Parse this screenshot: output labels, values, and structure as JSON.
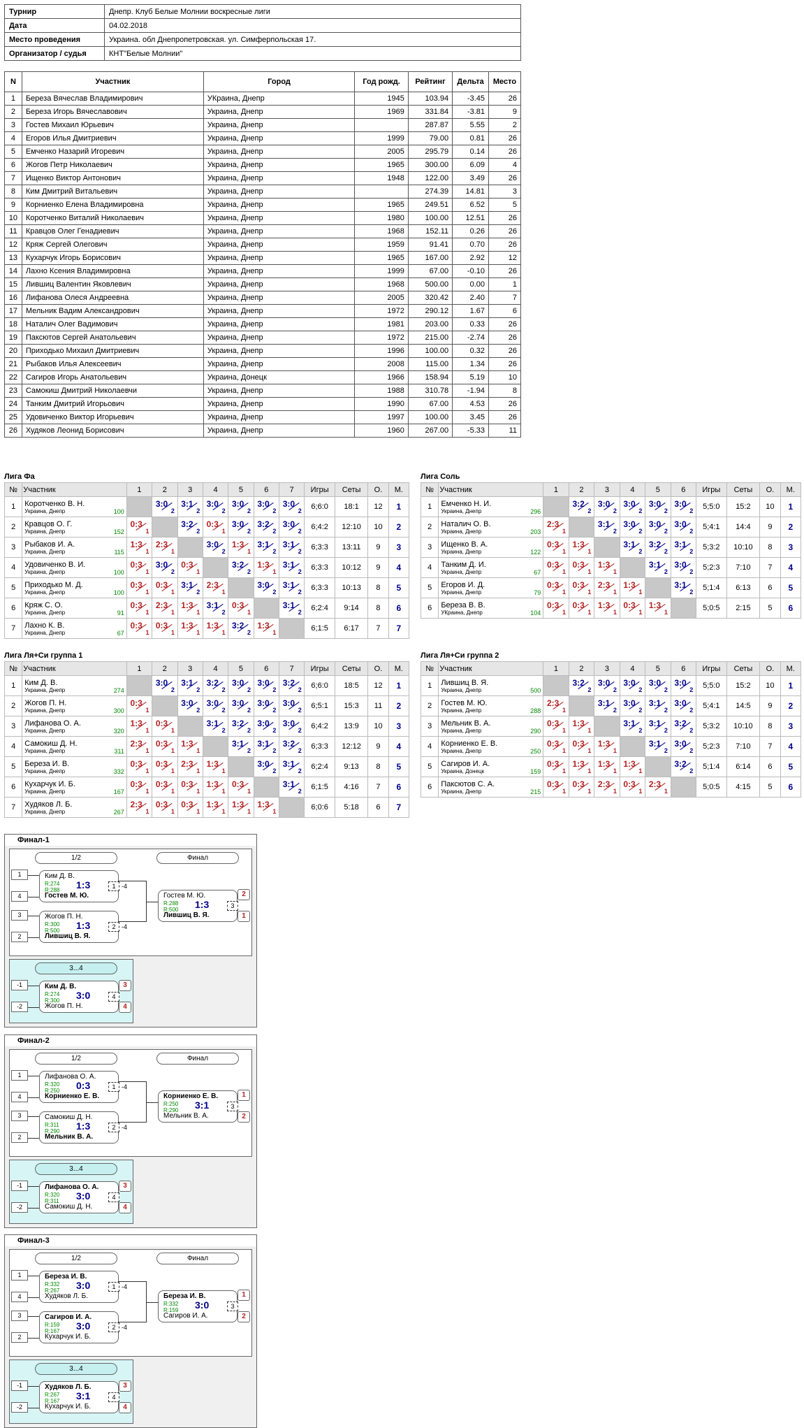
{
  "info": [
    {
      "k": "Турнир",
      "v": "Днепр. Клуб Белые Молнии воскресные лиги"
    },
    {
      "k": "Дата",
      "v": "04.02.2018"
    },
    {
      "k": "Место проведения",
      "v": "Украина. обл Днепропетровская. ул. Симферпольская 17."
    },
    {
      "k": "Организатор / судья",
      "v": "КНТ\"Белые Молнии\""
    }
  ],
  "players_header": [
    "N",
    "Участник",
    "Город",
    "Год рожд.",
    "Рейтинг",
    "Дельта",
    "Место"
  ],
  "players": [
    [
      "1",
      "Береза Вячеслав Владимирович",
      "УКраина, Днепр",
      "1945",
      "103.94",
      "-3.45",
      "26"
    ],
    [
      "2",
      "Береза Игорь Вячеславович",
      "Украина, Днепр",
      "1969",
      "331.84",
      "-3.81",
      "9"
    ],
    [
      "3",
      "Гостев Михаил Юрьевич",
      "Украина, Днепр",
      "",
      "287.87",
      "5.55",
      "2"
    ],
    [
      "4",
      "Егоров Илья Дмитриевич",
      "Украина, Днепр",
      "1999",
      "79.00",
      "0.81",
      "26"
    ],
    [
      "5",
      "Емченко Назарий Игоревич",
      "Украина, Днепр",
      "2005",
      "295.79",
      "0.14",
      "26"
    ],
    [
      "6",
      "Жогов Петр Николаевич",
      "Украина, Днепр",
      "1965",
      "300.00",
      "6.09",
      "4"
    ],
    [
      "7",
      "Ищенко Виктор Антонович",
      "Украина, Днепр",
      "1948",
      "122.00",
      "3.49",
      "26"
    ],
    [
      "8",
      "Ким Дмитрий Витальевич",
      "Украина, Днепр",
      "",
      "274.39",
      "14.81",
      "3"
    ],
    [
      "9",
      "Корниенко Елена Владимировна",
      "Украина, Днепр",
      "1965",
      "249.51",
      "6.52",
      "5"
    ],
    [
      "10",
      "Коротченко Виталий Николаевич",
      "Украина, Днепр",
      "1980",
      "100.00",
      "12.51",
      "26"
    ],
    [
      "11",
      "Кравцов Олег Генадиевич",
      "Украина, Днепр",
      "1968",
      "152.11",
      "0.26",
      "26"
    ],
    [
      "12",
      "Кряж Сергей Олегович",
      "Украина, Днепр",
      "1959",
      "91.41",
      "0.70",
      "26"
    ],
    [
      "13",
      "Кухарчук Игорь Борисович",
      "Украина, Днепр",
      "1965",
      "167.00",
      "2.92",
      "12"
    ],
    [
      "14",
      "Лахно Ксения Владимировна",
      "Украина, Днепр",
      "1999",
      "67.00",
      "-0.10",
      "26"
    ],
    [
      "15",
      "Лившиц Валентин Яковлевич",
      "Украина, Днепр",
      "1968",
      "500.00",
      "0.00",
      "1"
    ],
    [
      "16",
      "Лифанова Олеся Андреевна",
      "Украина, Днепр",
      "2005",
      "320.42",
      "2.40",
      "7"
    ],
    [
      "17",
      "Мельник Вадим Александрович",
      "Украина, Днепр",
      "1972",
      "290.12",
      "1.67",
      "6"
    ],
    [
      "18",
      "Наталич Олег Вадимович",
      "Украина, Днепр",
      "1981",
      "203.00",
      "0.33",
      "26"
    ],
    [
      "19",
      "Паксютов Сергей Анатольевич",
      "Украина, Днепр",
      "1972",
      "215.00",
      "-2.74",
      "26"
    ],
    [
      "20",
      "Приходько Михаил Дмитриевич",
      "Украина, Днепр",
      "1996",
      "100.00",
      "0.32",
      "26"
    ],
    [
      "21",
      "Рыбаков Илья Алексеевич",
      "Украина, Днепр",
      "2008",
      "115.00",
      "1.34",
      "26"
    ],
    [
      "22",
      "Сагиров Игорь Анатольевич",
      "Украина, Донецк",
      "1966",
      "158.94",
      "5.19",
      "10"
    ],
    [
      "23",
      "Самокиш Дмитрий Николаевчи",
      "Украина, Днепр",
      "1988",
      "310.78",
      "-1.94",
      "8"
    ],
    [
      "24",
      "Танким Дмитрий Игорьович",
      "Украина, Днепр",
      "1990",
      "67.00",
      "4.53",
      "26"
    ],
    [
      "25",
      "Удовиченко Виктор Игорьевич",
      "Украина, Днепр",
      "1997",
      "100.00",
      "3.45",
      "26"
    ],
    [
      "26",
      "Худяков Леонид Борисович",
      "Украина, Днепр",
      "1960",
      "267.00",
      "-5.33",
      "11"
    ]
  ],
  "leagues": [
    {
      "title": "Лига Фа",
      "n": 7,
      "rows": [
        {
          "name": "Коротченко В. Н.",
          "city": "Украина, Днепр",
          "r": "100",
          "res": [
            "x",
            "3:0",
            "3:1",
            "3:0",
            "3:0",
            "3:0",
            "3:0"
          ],
          "games": "6;6:0",
          "sets": "18:1",
          "o": "12",
          "m": "1"
        },
        {
          "name": "Кравцов О. Г.",
          "city": "Украина, Днепр",
          "r": "152",
          "res": [
            "0:3",
            "x",
            "3:2",
            "0:3",
            "3:0",
            "3:2",
            "3:0"
          ],
          "games": "6;4:2",
          "sets": "12:10",
          "o": "10",
          "m": "2"
        },
        {
          "name": "Рыбаков И. А.",
          "city": "Украина, Днепр",
          "r": "115",
          "res": [
            "1:3",
            "2:3",
            "x",
            "3:0",
            "1:3",
            "3:1",
            "3:1"
          ],
          "games": "6;3:3",
          "sets": "13:11",
          "o": "9",
          "m": "3"
        },
        {
          "name": "Удовиченко В. И.",
          "city": "Украина, Днепр",
          "r": "100",
          "res": [
            "0:3",
            "3:0",
            "0:3",
            "x",
            "3:2",
            "1:3",
            "3:1"
          ],
          "games": "6;3:3",
          "sets": "10:12",
          "o": "9",
          "m": "4"
        },
        {
          "name": "Приходько М. Д.",
          "city": "Украина, Днепр",
          "r": "100",
          "res": [
            "0:3",
            "0:3",
            "3:1",
            "2:3",
            "x",
            "3:0",
            "3:1"
          ],
          "games": "6;3:3",
          "sets": "10:13",
          "o": "8",
          "m": "5"
        },
        {
          "name": "Кряж С. О.",
          "city": "Украина, Днепр",
          "r": "91",
          "res": [
            "0:3",
            "2:3",
            "1:3",
            "3:1",
            "0:3",
            "x",
            "3:1"
          ],
          "games": "6;2:4",
          "sets": "9:14",
          "o": "8",
          "m": "6"
        },
        {
          "name": "Лахно К. В.",
          "city": "Украина, Днепр",
          "r": "67",
          "res": [
            "0:3",
            "0:3",
            "1:3",
            "1:3",
            "3:2",
            "1:3",
            "x"
          ],
          "games": "6;1:5",
          "sets": "6:17",
          "o": "7",
          "m": "7"
        }
      ]
    },
    {
      "title": "Лига Соль",
      "n": 6,
      "rows": [
        {
          "name": "Емченко Н. И.",
          "city": "Украина, Днепр",
          "r": "296",
          "res": [
            "x",
            "3:2",
            "3:0",
            "3:0",
            "3:0",
            "3:0"
          ],
          "games": "5;5:0",
          "sets": "15:2",
          "o": "10",
          "m": "1"
        },
        {
          "name": "Наталич О. В.",
          "city": "Украина, Днепр",
          "r": "203",
          "res": [
            "2:3",
            "x",
            "3:1",
            "3:0",
            "3:0",
            "3:0"
          ],
          "games": "5;4:1",
          "sets": "14:4",
          "o": "9",
          "m": "2"
        },
        {
          "name": "Ищенко В. А.",
          "city": "Украина, Днепр",
          "r": "122",
          "res": [
            "0:3",
            "1:3",
            "x",
            "3:1",
            "3:2",
            "3:1"
          ],
          "games": "5;3:2",
          "sets": "10:10",
          "o": "8",
          "m": "3"
        },
        {
          "name": "Танким Д. И.",
          "city": "Украина, Днепр",
          "r": "67",
          "res": [
            "0:3",
            "0:3",
            "1:3",
            "x",
            "3:1",
            "3:0"
          ],
          "games": "5;2:3",
          "sets": "7:10",
          "o": "7",
          "m": "4"
        },
        {
          "name": "Егоров И. Д.",
          "city": "Украина, Днепр",
          "r": "79",
          "res": [
            "0:3",
            "0:3",
            "2:3",
            "1:3",
            "x",
            "3:1"
          ],
          "games": "5;1:4",
          "sets": "6:13",
          "o": "6",
          "m": "5"
        },
        {
          "name": "Береза В. В.",
          "city": "УКраина, Днепр",
          "r": "104",
          "res": [
            "0:3",
            "0:3",
            "1:3",
            "0:3",
            "1:3",
            "x"
          ],
          "games": "5;0:5",
          "sets": "2:15",
          "o": "5",
          "m": "6"
        }
      ]
    },
    {
      "title": "Лига Ля+Си группа 1",
      "n": 7,
      "rows": [
        {
          "name": "Ким Д. В.",
          "city": "Украина, Днепр",
          "r": "274",
          "res": [
            "x",
            "3:0",
            "3:1",
            "3:2",
            "3:0",
            "3:0",
            "3:2"
          ],
          "games": "6;6:0",
          "sets": "18:5",
          "o": "12",
          "m": "1"
        },
        {
          "name": "Жогов П. Н.",
          "city": "Украина, Днепр",
          "r": "300",
          "res": [
            "0:3",
            "x",
            "3:0",
            "3:0",
            "3:0",
            "3:0",
            "3:0"
          ],
          "games": "6;5:1",
          "sets": "15:3",
          "o": "11",
          "m": "2"
        },
        {
          "name": "Лифанова О. А.",
          "city": "Украина, Днепр",
          "r": "320",
          "res": [
            "1:3",
            "0:3",
            "x",
            "3:1",
            "3:2",
            "3:0",
            "3:0"
          ],
          "games": "6;4:2",
          "sets": "13:9",
          "o": "10",
          "m": "3"
        },
        {
          "name": "Самокиш Д. Н.",
          "city": "Украина, Днепр",
          "r": "311",
          "res": [
            "2:3",
            "0:3",
            "1:3",
            "x",
            "3:1",
            "3:1",
            "3:2"
          ],
          "games": "6;3:3",
          "sets": "12:12",
          "o": "9",
          "m": "4"
        },
        {
          "name": "Береза И. В.",
          "city": "Украина, Днепр",
          "r": "332",
          "res": [
            "0:3",
            "0:3",
            "2:3",
            "1:3",
            "x",
            "3:0",
            "3:1"
          ],
          "games": "6;2:4",
          "sets": "9:13",
          "o": "8",
          "m": "5"
        },
        {
          "name": "Кухарчук И. Б.",
          "city": "Украина, Днепр",
          "r": "167",
          "res": [
            "0:3",
            "0:3",
            "0:3",
            "1:3",
            "0:3",
            "x",
            "3:1"
          ],
          "games": "6;1:5",
          "sets": "4:16",
          "o": "7",
          "m": "6"
        },
        {
          "name": "Худяков Л. Б.",
          "city": "Украина, Днепр",
          "r": "267",
          "res": [
            "2:3",
            "0:3",
            "0:3",
            "1:3",
            "1:3",
            "1:3",
            "x"
          ],
          "games": "6;0:6",
          "sets": "5:18",
          "o": "6",
          "m": "7"
        }
      ]
    },
    {
      "title": "Лига Ля+Си группа 2",
      "n": 6,
      "rows": [
        {
          "name": "Лившиц В. Я.",
          "city": "Украина, Днепр",
          "r": "500",
          "res": [
            "x",
            "3:2",
            "3:0",
            "3:0",
            "3:0",
            "3:0"
          ],
          "games": "5;5:0",
          "sets": "15:2",
          "o": "10",
          "m": "1"
        },
        {
          "name": "Гостев М. Ю.",
          "city": "Украина, Днепр",
          "r": "288",
          "res": [
            "2:3",
            "x",
            "3:1",
            "3:0",
            "3:1",
            "3:0"
          ],
          "games": "5;4:1",
          "sets": "14:5",
          "o": "9",
          "m": "2"
        },
        {
          "name": "Мельник В. А.",
          "city": "Украина, Днепр",
          "r": "290",
          "res": [
            "0:3",
            "1:3",
            "x",
            "3:1",
            "3:1",
            "3:2"
          ],
          "games": "5;3:2",
          "sets": "10:10",
          "o": "8",
          "m": "3"
        },
        {
          "name": "Корниенко Е. В.",
          "city": "Украина, Днепр",
          "r": "250",
          "res": [
            "0:3",
            "0:3",
            "1:3",
            "x",
            "3:1",
            "3:0"
          ],
          "games": "5;2:3",
          "sets": "7:10",
          "o": "7",
          "m": "4"
        },
        {
          "name": "Сагиров И. А.",
          "city": "Украина, Донецк",
          "r": "159",
          "res": [
            "0:3",
            "1:3",
            "1:3",
            "1:3",
            "x",
            "3:2"
          ],
          "games": "5;1:4",
          "sets": "6:14",
          "o": "6",
          "m": "5"
        },
        {
          "name": "Паксютов С. А.",
          "city": "Украина, Днепр",
          "r": "215",
          "res": [
            "0:3",
            "0:3",
            "2:3",
            "0:3",
            "2:3",
            "x"
          ],
          "games": "5;0:5",
          "sets": "4:15",
          "o": "5",
          "m": "6"
        }
      ]
    }
  ],
  "league_header": {
    "no": "№",
    "name": "Участник",
    "games": "Игры",
    "sets": "Сеты",
    "o": "О.",
    "m": "М."
  },
  "finals": [
    {
      "title": "Финал-1",
      "half": "1/2",
      "final": "Финал",
      "third": "3...4",
      "m1": {
        "top": "Ким Д. В.",
        "rt": "R:274",
        "bot": "Гостев М. Ю.",
        "rb": "R:288",
        "s": "1:3",
        "n": "1",
        "st": "1",
        "sb": "4",
        "wb": true,
        "loss": "-4"
      },
      "m2": {
        "top": "Жогов П. Н.",
        "rt": "R:300",
        "bot": "Лившиц В. Я.",
        "rb": "R:500",
        "s": "1:3",
        "n": "2",
        "st": "3",
        "sb": "2",
        "wb": true,
        "loss": "-4"
      },
      "mf": {
        "top": "Гостев М. Ю.",
        "rt": "R:288",
        "bot": "Лившиц В. Я.",
        "rb": "R:500",
        "s": "1:3",
        "n": "3",
        "pt": "2",
        "pb": "1",
        "wb": true
      },
      "m3": {
        "top": "Ким Д. В.",
        "rt": "R:274",
        "bot": "Жогов П. Н.",
        "rb": "R:300",
        "s": "3:0",
        "n": "4",
        "st": "-1",
        "sb": "-2",
        "wb": false,
        "pt": "3",
        "pb": "4"
      }
    },
    {
      "title": "Финал-2",
      "half": "1/2",
      "final": "Финал",
      "third": "3...4",
      "m1": {
        "top": "Лифанова О. А.",
        "rt": "R:320",
        "bot": "Корниенко Е. В.",
        "rb": "R:250",
        "s": "0:3",
        "n": "1",
        "st": "1",
        "sb": "4",
        "wb": true,
        "loss": "-4"
      },
      "m2": {
        "top": "Самокиш Д. Н.",
        "rt": "R:311",
        "bot": "Мельник В. А.",
        "rb": "R:290",
        "s": "1:3",
        "n": "2",
        "st": "3",
        "sb": "2",
        "wb": true,
        "loss": "-4"
      },
      "mf": {
        "top": "Корниенко Е. В.",
        "rt": "R:250",
        "bot": "Мельник В. А.",
        "rb": "R:290",
        "s": "3:1",
        "n": "3",
        "pt": "1",
        "pb": "2",
        "wb": false
      },
      "m3": {
        "top": "Лифанова О. А.",
        "rt": "R:320",
        "bot": "Самокиш Д. Н.",
        "rb": "R:311",
        "s": "3:0",
        "n": "4",
        "st": "-1",
        "sb": "-2",
        "wb": false,
        "pt": "3",
        "pb": "4"
      }
    },
    {
      "title": "Финал-3",
      "half": "1/2",
      "final": "Финал",
      "third": "3...4",
      "m1": {
        "top": "Береза И. В.",
        "rt": "R:332",
        "bot": "Худяков Л. Б.",
        "rb": "R:267",
        "s": "3:0",
        "n": "1",
        "st": "1",
        "sb": "4",
        "wb": false,
        "loss": "-4"
      },
      "m2": {
        "top": "Сагиров И. А.",
        "rt": "R:159",
        "bot": "Кухарчук И. Б.",
        "rb": "R:167",
        "s": "3:0",
        "n": "2",
        "st": "3",
        "sb": "2",
        "wb": false,
        "loss": "-4"
      },
      "mf": {
        "top": "Береза И. В.",
        "rt": "R:332",
        "bot": "Сагиров И. А.",
        "rb": "R:159",
        "s": "3:0",
        "n": "3",
        "pt": "1",
        "pb": "2",
        "wb": false
      },
      "m3": {
        "top": "Худяков Л. Б.",
        "rt": "R:267",
        "bot": "Кухарчук И. Б.",
        "rb": "R:167",
        "s": "3:1",
        "n": "4",
        "st": "-1",
        "sb": "-2",
        "wb": false,
        "pt": "3",
        "pb": "4"
      }
    }
  ]
}
